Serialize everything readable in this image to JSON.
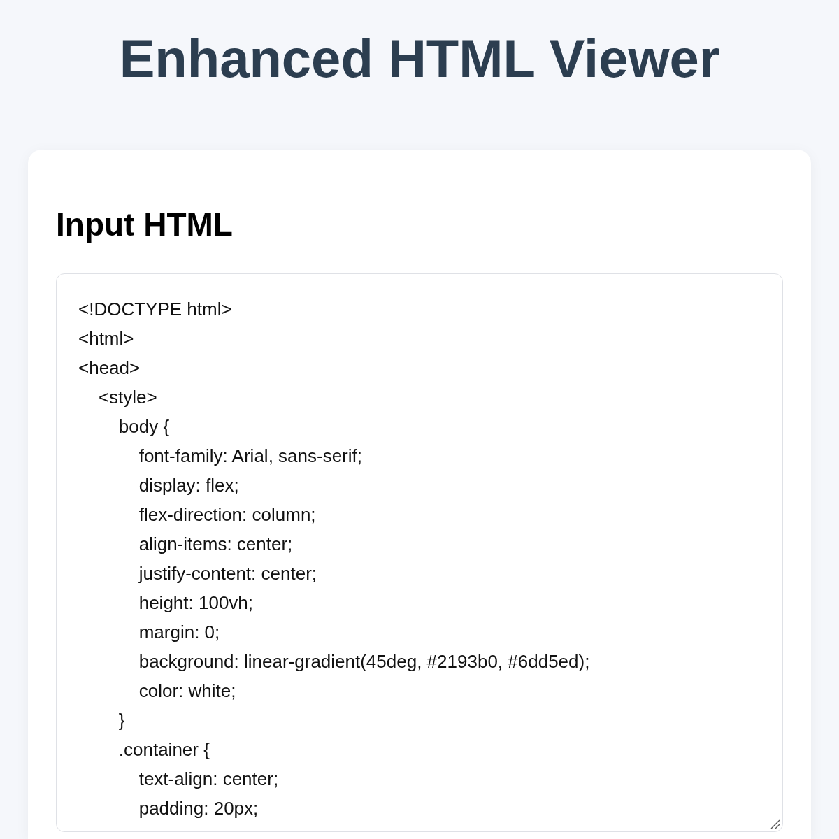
{
  "page": {
    "title": "Enhanced HTML Viewer"
  },
  "input_panel": {
    "heading": "Input HTML",
    "textarea": {
      "value": [
        "<!DOCTYPE html>",
        "<html>",
        "<head>",
        "    <style>",
        "        body {",
        "            font-family: Arial, sans-serif;",
        "            display: flex;",
        "            flex-direction: column;",
        "            align-items: center;",
        "            justify-content: center;",
        "            height: 100vh;",
        "            margin: 0;",
        "            background: linear-gradient(45deg, #2193b0, #6dd5ed);",
        "            color: white;",
        "        }",
        "        .container {",
        "            text-align: center;",
        "            padding: 20px;"
      ]
    }
  }
}
